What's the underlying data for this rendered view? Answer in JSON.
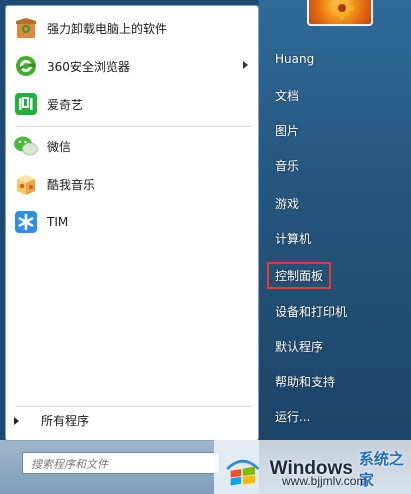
{
  "pinned_programs": [
    {
      "label": "强力卸载电脑上的软件",
      "icon": "uninstall-box-icon"
    },
    {
      "label": "360安全浏览器",
      "icon": "360-browser-icon",
      "has_submenu": true
    },
    {
      "label": "爱奇艺",
      "icon": "iqiyi-icon"
    }
  ],
  "recent_programs": [
    {
      "label": "微信",
      "icon": "wechat-icon"
    },
    {
      "label": "酷我音乐",
      "icon": "kuwo-music-icon"
    },
    {
      "label": "TIM",
      "icon": "tim-icon"
    }
  ],
  "all_programs_label": "所有程序",
  "search": {
    "placeholder": "搜索程序和文件"
  },
  "right_panel": {
    "user": "Huang",
    "documents": "文档",
    "pictures": "图片",
    "music": "音乐",
    "games": "游戏",
    "computer": "计算机",
    "control_panel": "控制面板",
    "devices_printers": "设备和打印机",
    "default_programs": "默认程序",
    "help_support": "帮助和支持",
    "run": "运行..."
  },
  "watermark": {
    "brand": "Windows",
    "site_cn": "系统之家",
    "url": "www.bjjmlv.com"
  },
  "colors": {
    "highlight_border": "#e53935"
  }
}
